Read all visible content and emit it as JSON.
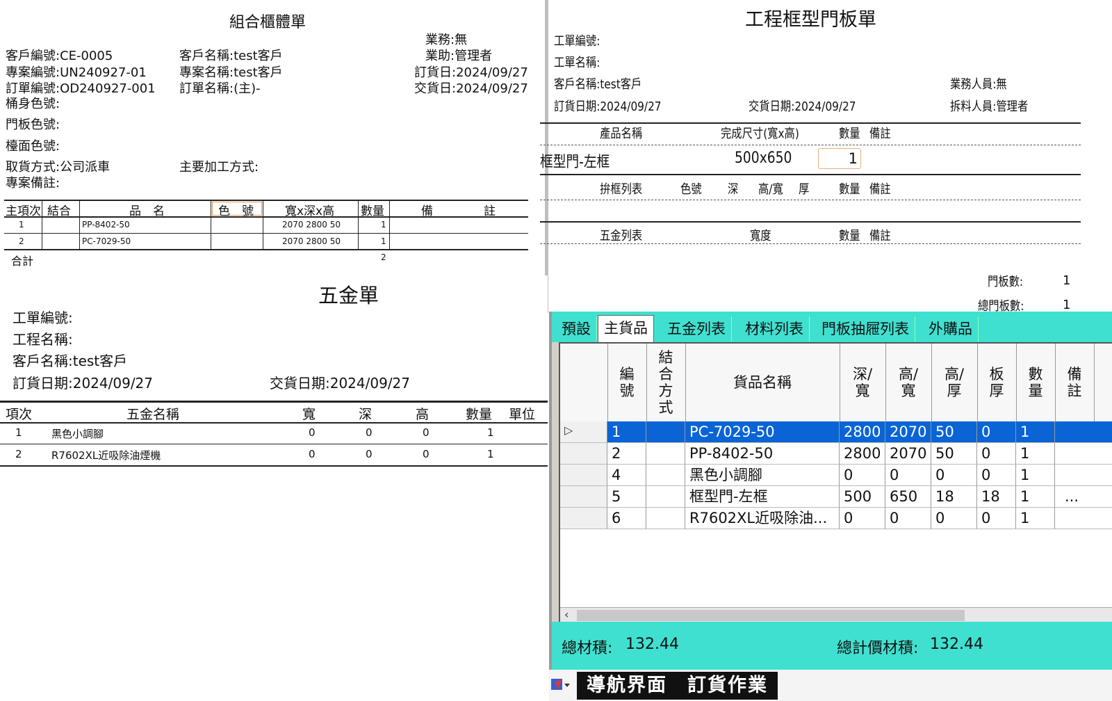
{
  "cabinet": {
    "title": "組合櫃體單",
    "sales": "業務:無",
    "assistant": "業助:管理者",
    "customer_no": "客戶編號:CE-0005",
    "customer_name": "客戶名稱:test客戶",
    "order_date": "訂貨日:2024/09/27",
    "project_no": "專案編號:UN240927-01",
    "project_name": "專案名稱:test客戶",
    "delivery_date": "交貨日:2024/09/27",
    "order_no": "訂單編號:OD240927-001",
    "order_name": "訂單名稱:(主)-",
    "body_color": "桶身色號:",
    "door_color": "門板色號:",
    "top_color": "檯面色號:",
    "pickup": "取貨方式:公司派車",
    "process": "主要加工方式:",
    "remark": "專案備註:",
    "headers": [
      "主項次",
      "結合",
      "品　名",
      "色　號",
      "寬x深x高",
      "數量",
      "備",
      "註"
    ],
    "rows": [
      {
        "no": "1",
        "name": "PP-8402-50",
        "size": "2070 2800 50",
        "qty": "1"
      },
      {
        "no": "2",
        "name": "PC-7029-50",
        "size": "2070 2800 50",
        "qty": "1"
      }
    ],
    "total_label": "合計",
    "total_qty": "2"
  },
  "frame": {
    "title": "工程框型門板單",
    "work_no": "工單編號:",
    "work_name": "工單名稱:",
    "customer": "客戶名稱:test客戶",
    "sales": "業務人員:無",
    "order_date": "訂貨日期:2024/09/27",
    "delivery": "交貨日期:2024/09/27",
    "splitter": "拆料人員:管理者",
    "h1": [
      "產品名稱",
      "完成尺寸(寬x高)",
      "數量",
      "備註"
    ],
    "product": "框型門-左框",
    "size": "500x650",
    "qty": "1",
    "h2": [
      "拚框列表",
      "色號",
      "深",
      "高/寬",
      "厚",
      "數量",
      "備註"
    ],
    "h3": [
      "五金列表",
      "寬度",
      "數量",
      "備註"
    ],
    "door_count_label": "門板數:",
    "door_count": "1",
    "total_door_label": "總門板數:",
    "total_door": "1"
  },
  "hardware": {
    "title": "五金單",
    "work_no": "工單編號:",
    "work_name": "工程名稱:",
    "customer": "客戶名稱:test客戶",
    "order_date": "訂貨日期:2024/09/27",
    "delivery": "交貨日期:2024/09/27",
    "headers": [
      "項次",
      "五金名稱",
      "寬",
      "深",
      "高",
      "數量",
      "單位"
    ],
    "rows": [
      {
        "no": "1",
        "name": "黑色小調腳",
        "w": "0",
        "d": "0",
        "h": "0",
        "qty": "1"
      },
      {
        "no": "2",
        "name": "R7602XL近吸除油煙機",
        "w": "0",
        "d": "0",
        "h": "0",
        "qty": "1"
      }
    ]
  },
  "window": {
    "tabs": [
      "預設",
      "主貨品",
      "五金列表",
      "材料列表",
      "門板抽屜列表",
      "外購品"
    ],
    "active_tab": "主貨品",
    "columns": [
      "編\n號",
      "結\n合\n方\n式",
      "貨品名稱",
      "深/\n寬",
      "高/\n寬",
      "高/\n厚",
      "板\n厚",
      "數\n量",
      "備\n註"
    ],
    "rows": [
      {
        "no": "1",
        "join": "",
        "name": "PC-7029-50",
        "d": "2800",
        "h": "2070",
        "t": "50",
        "b": "0",
        "q": "1",
        "r": ""
      },
      {
        "no": "2",
        "join": "",
        "name": "PP-8402-50",
        "d": "2800",
        "h": "2070",
        "t": "50",
        "b": "0",
        "q": "1",
        "r": ""
      },
      {
        "no": "4",
        "join": "",
        "name": "黑色小調腳",
        "d": "0",
        "h": "0",
        "t": "0",
        "b": "0",
        "q": "1",
        "r": ""
      },
      {
        "no": "5",
        "join": "",
        "name": "框型門-左框",
        "d": "500",
        "h": "650",
        "t": "18",
        "b": "18",
        "q": "1",
        "r": "..."
      },
      {
        "no": "6",
        "join": "",
        "name": "R7602XL近吸除油...",
        "d": "0",
        "h": "0",
        "t": "0",
        "b": "0",
        "q": "1",
        "r": ""
      }
    ],
    "total_material_label": "總材積:",
    "total_material": "132.44",
    "total_price_material_label": "總計價材積:",
    "total_price_material": "132.44",
    "accent": "#40e0d0",
    "selection": "#0a64d6"
  },
  "taskbar": {
    "label": "導航界面　訂貨作業",
    "icon": "app-icon"
  }
}
